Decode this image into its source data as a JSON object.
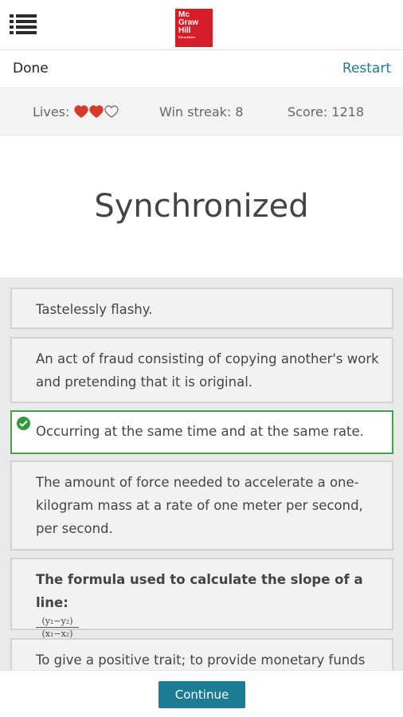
{
  "header": {
    "menu_icon": "hamburger-menu-icon",
    "logo": {
      "line1": "Mc",
      "line2": "Graw",
      "line3": "Hill",
      "line4": "Education",
      "color": "#d71e28"
    }
  },
  "nav": {
    "done_label": "Done",
    "restart_label": "Restart",
    "accent_color": "#1c7c93"
  },
  "status": {
    "lives_label": "Lives:",
    "lives_total": 3,
    "lives_remaining": 2,
    "heart_color": "#d9392b",
    "streak_text": "Win streak: 8",
    "score_text": "Score: 1218"
  },
  "question": {
    "word": "Synchronized"
  },
  "options": [
    {
      "text": "Tastelessly flashy.",
      "selected": false
    },
    {
      "text": "An act of fraud consisting of copying another's work and pretending that it is original.",
      "selected": false
    },
    {
      "text": "Occurring at the same time and at the same rate.",
      "selected": true
    },
    {
      "text": "The amount of force needed to accelerate a one-kilogram mass at a rate of one meter per second, per second.",
      "selected": false
    },
    {
      "text": "The formula used to calculate the slope of a line:",
      "numerator": "(y₁−y₂)",
      "denominator": "(x₁−x₂)",
      "selected": false
    },
    {
      "text": "To give a positive trait; to provide monetary funds",
      "selected": false
    }
  ],
  "footer": {
    "continue_label": "Continue"
  },
  "colors": {
    "selected_border": "#3fa648",
    "check_fill": "#2e9a3a"
  }
}
